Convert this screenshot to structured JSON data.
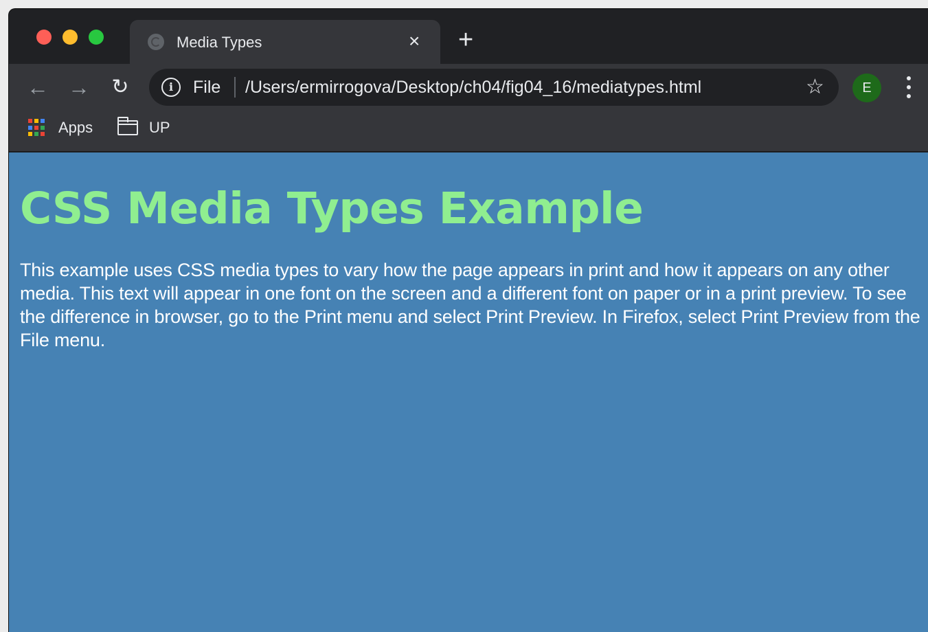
{
  "browser": {
    "tab": {
      "title": "Media Types",
      "close_glyph": "×"
    },
    "new_tab_glyph": "+",
    "toolbar": {
      "back_glyph": "←",
      "forward_glyph": "→",
      "reload_glyph": "↻",
      "info_glyph": "i",
      "scheme_label": "File",
      "url": "/Users/ermirrogova/Desktop/ch04/fig04_16/mediatypes.html",
      "bookmark_star_glyph": "☆",
      "profile_initial": "E"
    },
    "bookmarks": [
      {
        "label": "Apps",
        "icon": "apps-grid-icon"
      },
      {
        "label": "UP",
        "icon": "folder-icon"
      }
    ]
  },
  "page": {
    "heading": "CSS Media Types Example",
    "body": "This example uses CSS media types to vary how the page appears in print and how it appears on any other media. This text will appear in one font on the screen and a different font on paper or in a print preview. To see the difference in browser, go to the Print menu and select Print Preview. In Firefox, select Print Preview from the File menu.",
    "background_color": "#4682b4",
    "heading_color": "#90ee90",
    "text_color": "#ffffff"
  },
  "colors": {
    "chrome_dark": "#202124",
    "chrome_toolbar": "#35363a",
    "profile_green": "#1e6a1a"
  }
}
